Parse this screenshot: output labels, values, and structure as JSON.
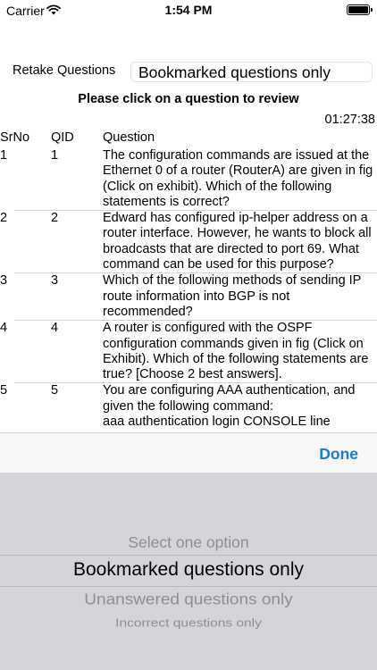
{
  "status_bar": {
    "carrier": "Carrier",
    "time": "1:54 PM",
    "wifi_icon": "wifi-icon",
    "battery_icon": "battery-icon",
    "battery_level": 1.0
  },
  "controls": {
    "retake_label": "Retake Questions",
    "filter_value": "Bookmarked questions only"
  },
  "instruction": "Please click on a question to review",
  "timer": "01:27:38",
  "table": {
    "headers": {
      "srno": "SrNo",
      "qid": "QID",
      "question": "Question"
    },
    "rows": [
      {
        "srno": "1",
        "qid": "1",
        "question": "The configuration commands are issued at the Ethernet 0 of a router (RouterA) are given in fig (Click on exhibit). Which of the following statements is correct?"
      },
      {
        "srno": "2",
        "qid": "2",
        "question": "Edward has configured ip-helper address on a router interface. However, he wants to block all broadcasts that are directed to port 69. What command can be used for this purpose?"
      },
      {
        "srno": "3",
        "qid": "3",
        "question": "Which of the following methods of sending IP route information into BGP is not recommended?"
      },
      {
        "srno": "4",
        "qid": "4",
        "question": "A router is configured with the OSPF configuration commands given in fig (Click on Exhibit). Which of the following statements are true? [Choose 2 best answers]."
      },
      {
        "srno": "5",
        "qid": "5",
        "question": "You are configuring AAA authentication, and given the following command:\n                aaa authentication login CONSOLE line"
      }
    ]
  },
  "picker": {
    "done_label": "Done",
    "options": [
      "Select one option",
      "Bookmarked questions only",
      "Unanswered questions only",
      "Incorrect questions only"
    ],
    "selected": "Bookmarked questions only"
  }
}
